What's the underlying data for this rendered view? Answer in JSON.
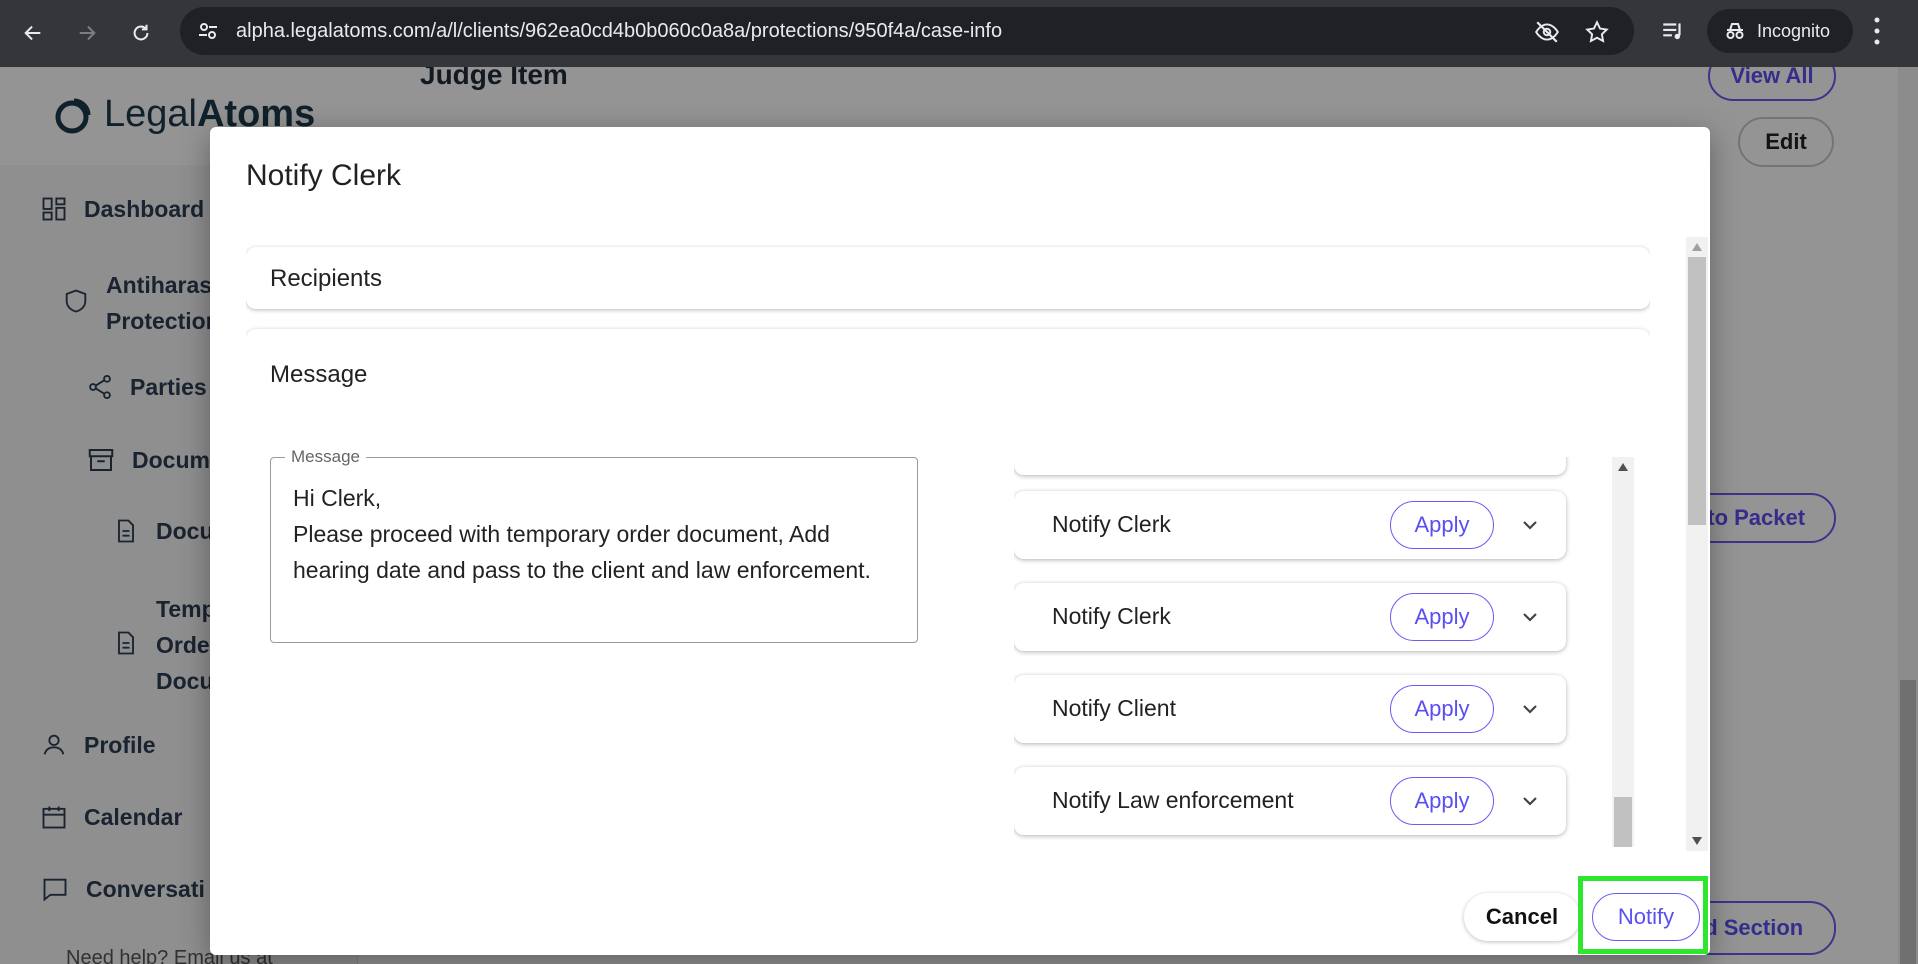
{
  "browser": {
    "url": "alpha.legalatoms.com/a/l/clients/962ea0cd4b0b060c0a8a/protections/950f4a/case-info",
    "incognito_label": "Incognito"
  },
  "brand": {
    "prefix": "Legal",
    "bold": "Atoms"
  },
  "sidebar": {
    "items": [
      {
        "label": "Dashboard",
        "icon": "dashboard-icon"
      },
      {
        "label": "Antiharas",
        "label2": "Protection",
        "icon": "shield-icon"
      },
      {
        "label": "Parties",
        "icon": "share-icon"
      },
      {
        "label": "Docume",
        "icon": "archive-icon"
      },
      {
        "label": "Docu",
        "icon": "document-icon"
      },
      {
        "label": "Temp",
        "label2": "Orde",
        "label3": "Docu",
        "icon": "document-icon"
      },
      {
        "label": "Profile",
        "icon": "person-icon"
      },
      {
        "label": "Calendar",
        "icon": "calendar-icon"
      },
      {
        "label": "Conversati",
        "icon": "chat-icon"
      }
    ],
    "help_text": "Need help? Email us at"
  },
  "background": {
    "judge_title": "Judge Item",
    "view_all": "View All",
    "edit": "Edit",
    "to_packet": "e to Packet",
    "add_section": "dd Section"
  },
  "modal": {
    "title": "Notify Clerk",
    "recipients_title": "Recipients",
    "message_title": "Message",
    "message_legend": "Message",
    "message_text": "Hi Clerk,\nPlease proceed with temporary order document, Add hearing date and pass to the client and law enforcement.",
    "templates": [
      {
        "label": "Notify Clerk",
        "apply": "Apply"
      },
      {
        "label": "Notify Clerk",
        "apply": "Apply"
      },
      {
        "label": "Notify Client",
        "apply": "Apply"
      },
      {
        "label": "Notify Law enforcement",
        "apply": "Apply"
      }
    ],
    "cancel_label": "Cancel",
    "notify_label": "Notify"
  },
  "colors": {
    "accent": "#5a4ff0",
    "highlight": "#2ee62e"
  }
}
